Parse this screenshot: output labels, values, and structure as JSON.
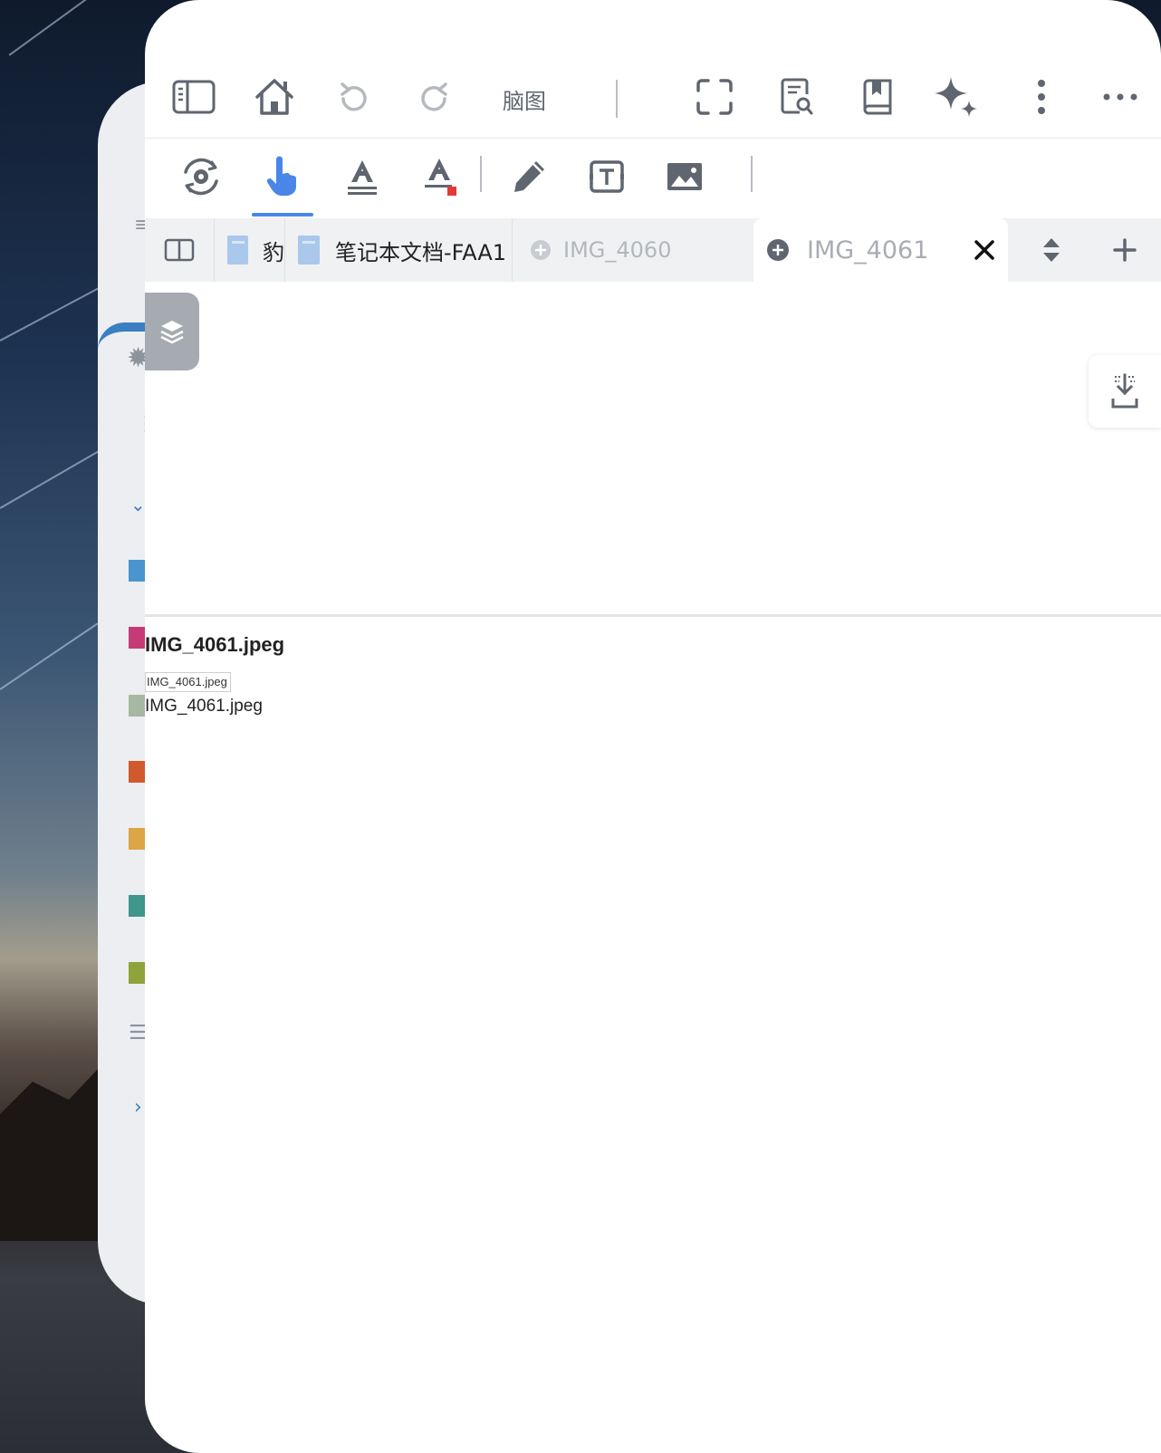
{
  "toolbar": {
    "mindmap_label": "脑图",
    "icons": [
      "sidebar-toggle-icon",
      "home-icon",
      "undo-icon",
      "redo-icon",
      "fullscreen-icon",
      "search-document-icon",
      "bookmark-book-icon",
      "ai-sparkle-icon",
      "vertical-more-icon",
      "horizontal-more-icon"
    ]
  },
  "tools": {
    "icons": [
      "settings-sync-icon",
      "hand-pointer-icon",
      "text-underline-icon",
      "text-color-icon",
      "pencil-icon",
      "text-box-icon",
      "image-icon"
    ],
    "active": "hand-pointer-icon",
    "accent_color": "#4a86e8"
  },
  "tabs": [
    {
      "label": "豹",
      "type": "document",
      "active": false
    },
    {
      "label": "笔记本文档-FAA1",
      "type": "document",
      "active": false
    },
    {
      "label": "IMG_4060",
      "type": "image",
      "active": false
    },
    {
      "label": "IMG_4061",
      "type": "image",
      "active": true
    }
  ],
  "content": {
    "title": "IMG_4061.jpeg",
    "image_alt": "IMG_4061.jpeg",
    "caption": "IMG_4061.jpeg"
  },
  "background_app": {
    "color_labels": [
      "#4b95cf",
      "#c73a78",
      "#a7b8a2",
      "#cf5a2c",
      "#dca646",
      "#3f968b",
      "#8fa33b"
    ]
  }
}
